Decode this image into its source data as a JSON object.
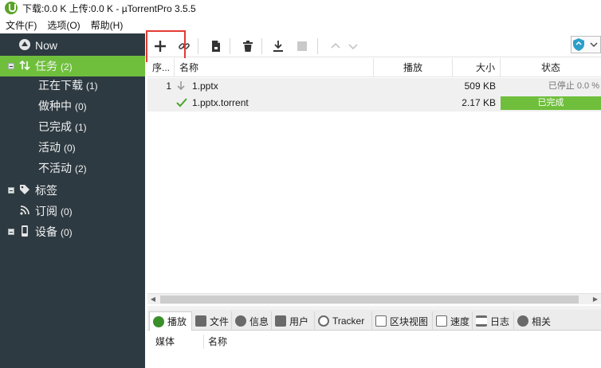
{
  "title_bar": {
    "text": "下载:0.0 K 上传:0.0 K - µTorrentPro 3.5.5"
  },
  "menu": [
    {
      "label": "文件(F)"
    },
    {
      "label": "选项(O)"
    },
    {
      "label": "帮助(H)"
    }
  ],
  "sidebar": {
    "now": {
      "label": "Now"
    },
    "tasks": {
      "label": "任务",
      "count": "(2)"
    },
    "downloading": {
      "label": "正在下载",
      "count": "(1)"
    },
    "seeding": {
      "label": "做种中",
      "count": "(0)"
    },
    "completed": {
      "label": "已完成",
      "count": "(1)"
    },
    "active": {
      "label": "活动",
      "count": "(0)"
    },
    "inactive": {
      "label": "不活动",
      "count": "(2)"
    },
    "labels": {
      "label": "标签"
    },
    "feeds": {
      "label": "订阅",
      "count": "(0)"
    },
    "devices": {
      "label": "设备",
      "count": "(0)"
    }
  },
  "table": {
    "columns": {
      "seq": "序...",
      "name": "名称",
      "play": "播放",
      "size": "大小",
      "status": "状态"
    },
    "rows": [
      {
        "seq": "1",
        "name": "1.pptx",
        "size": "509 KB",
        "status": "已停止 0.0 %"
      },
      {
        "seq": "",
        "name": "1.pptx.torrent",
        "size": "2.17 KB",
        "status": "已完成"
      }
    ]
  },
  "detail_tabs": {
    "play": "播放",
    "files": "文件",
    "info": "信息",
    "peers": "用户",
    "tracker": "Tracker",
    "pieces": "区块视图",
    "speed": "速度",
    "logger": "日志",
    "related": "相关"
  },
  "detail_columns": {
    "media": "媒体",
    "name": "名称"
  },
  "colors": {
    "sidebar_bg": "#2e3a41",
    "accent_green": "#6fbf3c",
    "highlight_red": "#e23b33"
  }
}
